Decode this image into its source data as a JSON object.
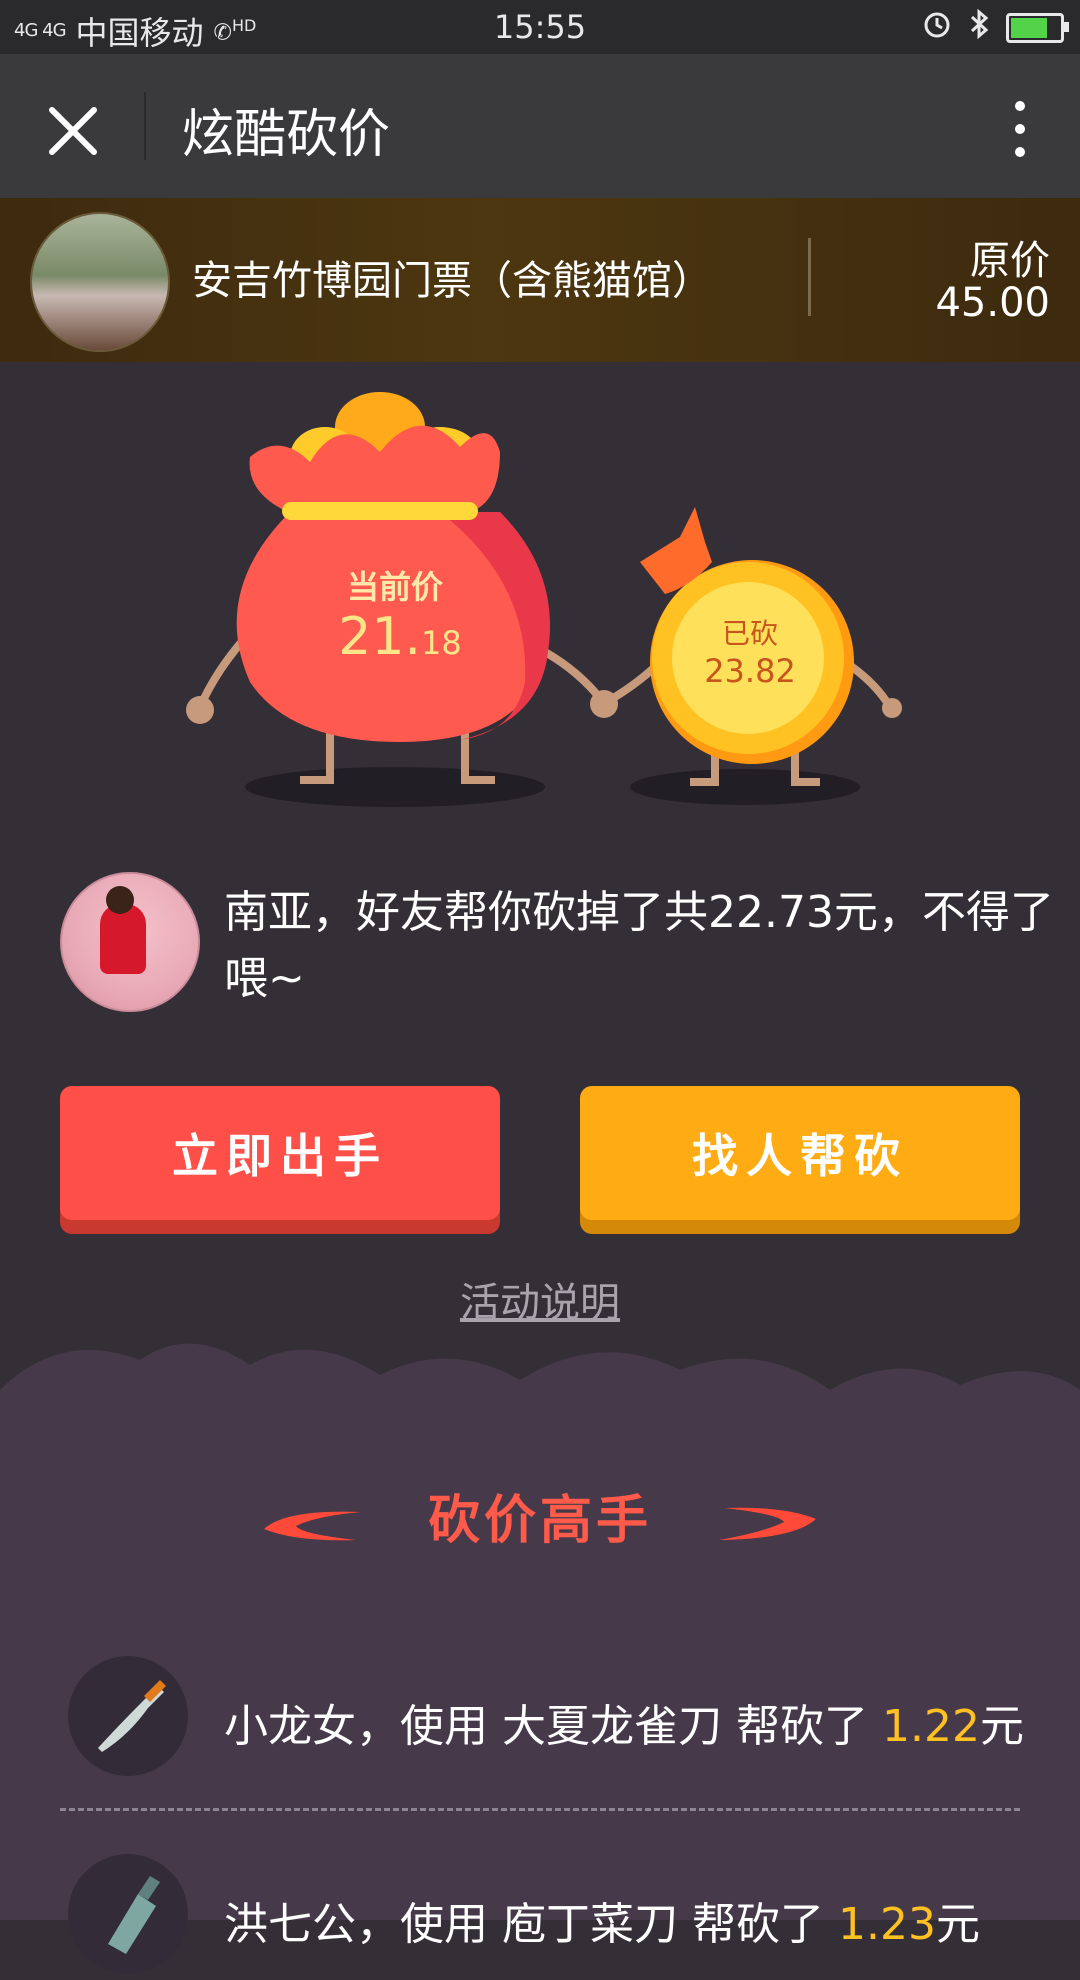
{
  "status_bar": {
    "network": "4G 4G",
    "carrier": "中国移动",
    "hd": "HD",
    "time": "15:55"
  },
  "nav": {
    "title": "炫酷砍价"
  },
  "product": {
    "name": "安吉竹博园门票（含熊猫馆）",
    "price_label": "原价",
    "price_value": "45.00"
  },
  "mascot": {
    "current_label": "当前价",
    "current_int": "21.",
    "current_dec": "18",
    "cut_label": "已砍",
    "cut_value": "23.82"
  },
  "message": {
    "text": "南亚，好友帮你砍掉了共22.73元，不得了喂~"
  },
  "actions": {
    "buy_label": "立即出手",
    "help_label": "找人帮砍",
    "rules_label": "活动说明"
  },
  "leaderboard": {
    "title": "砍价高手",
    "items": [
      {
        "text": "小龙女，使用 大夏龙雀刀 帮砍了 ",
        "amount": "1.22",
        "unit": "元"
      },
      {
        "text": "洪七公，使用 庖丁菜刀 帮砍了 ",
        "amount": "1.23",
        "unit": "元"
      }
    ]
  },
  "colors": {
    "background": "#342f36",
    "buy_button": "#fe5048",
    "help_button": "#ffac14",
    "accent_title": "#ff5a4a",
    "amount": "#ffc122"
  },
  "icons": {
    "close": "close-icon",
    "menu": "more-vertical-icon",
    "alarm": "alarm-icon",
    "bluetooth": "bluetooth-icon",
    "battery": "battery-charging-icon",
    "call": "hd-call-icon"
  }
}
